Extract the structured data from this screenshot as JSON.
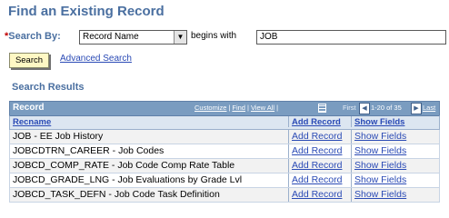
{
  "page": {
    "title": "Find an Existing Record"
  },
  "search": {
    "required_marker": "*",
    "label": "Search By:",
    "field_selected": "Record Name",
    "operator": "begins with",
    "value": "JOB",
    "search_button": "Search",
    "advanced_link": "Advanced Search"
  },
  "results": {
    "section_title": "Search Results",
    "grid_caption": "Record",
    "tools": {
      "customize": "Customize",
      "find": "Find",
      "view_all": "View All",
      "sep": "|"
    },
    "paging": {
      "first": "First",
      "range": "1-20 of 35",
      "last": "Last"
    },
    "columns": {
      "recname": "Recname",
      "add_record": "Add Record",
      "show_fields": "Show Fields"
    },
    "rows": [
      {
        "recname": "JOB - EE Job History",
        "add": "Add Record",
        "show": "Show Fields"
      },
      {
        "recname": "JOBCDTRN_CAREER - Job Codes",
        "add": "Add Record",
        "show": "Show Fields"
      },
      {
        "recname": "JOBCD_COMP_RATE - Job Code Comp Rate Table",
        "add": "Add Record",
        "show": "Show Fields"
      },
      {
        "recname": "JOBCD_GRADE_LNG - Job Evaluations by Grade Lvl",
        "add": "Add Record",
        "show": "Show Fields"
      },
      {
        "recname": "JOBCD_TASK_DEFN - Job Code Task Definition",
        "add": "Add Record",
        "show": "Show Fields"
      }
    ]
  },
  "colors": {
    "title": "#4a6fa0",
    "grid_header": "#7a9cc0",
    "link": "#2a4ab5",
    "button_bg": "#fff8c4",
    "required": "#c00000"
  },
  "icons": {
    "dropdown": "chevron-down-icon",
    "download": "download-grid-icon",
    "prev": "arrow-left-icon",
    "next": "arrow-right-icon"
  }
}
